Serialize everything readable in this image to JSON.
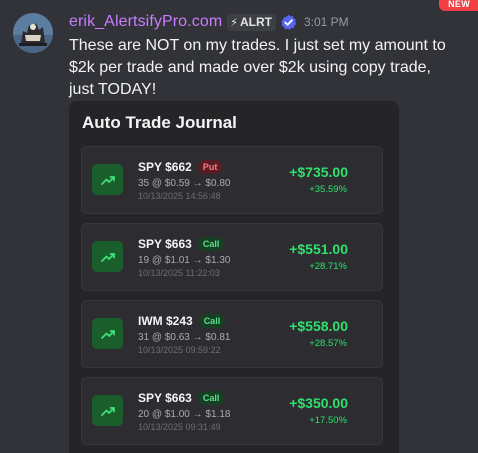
{
  "badge": "NEW",
  "author": {
    "name": "erik_AlertsifyPro.com",
    "tag": "ALRT",
    "tag_icon": "lightning-icon",
    "verified_icon": "verified-check-icon",
    "timestamp": "3:01 PM"
  },
  "message": "These are NOT on my trades. I just set my amount to $2k per trade and made over $2k using copy trade, just TODAY!",
  "journal": {
    "title": "Auto Trade Journal",
    "trades": [
      {
        "symbol": "SPY $662",
        "type": "Put",
        "detail": "35 @ $0.59 → $0.80",
        "time": "10/13/2025 14:56:48",
        "pnl": "+$735.00",
        "pct": "+35.59%"
      },
      {
        "symbol": "SPY $663",
        "type": "Call",
        "detail": "19 @ $1.01 → $1.30",
        "time": "10/13/2025 11:22:03",
        "pnl": "+$551.00",
        "pct": "+28.71%"
      },
      {
        "symbol": "IWM $243",
        "type": "Call",
        "detail": "31 @ $0.63 → $0.81",
        "time": "10/13/2025 09:59:22",
        "pnl": "+$558.00",
        "pct": "+28.57%"
      },
      {
        "symbol": "SPY $663",
        "type": "Call",
        "detail": "20 @ $1.00 → $1.18",
        "time": "10/13/2025 09:31:49",
        "pnl": "+$350.00",
        "pct": "+17.50%"
      }
    ]
  },
  "colors": {
    "background": "#323339",
    "username": "#c77dff",
    "profit": "#2fe06c",
    "put": "#ff7d8a",
    "call": "#5fe08a",
    "new_badge": "#f23f43"
  }
}
